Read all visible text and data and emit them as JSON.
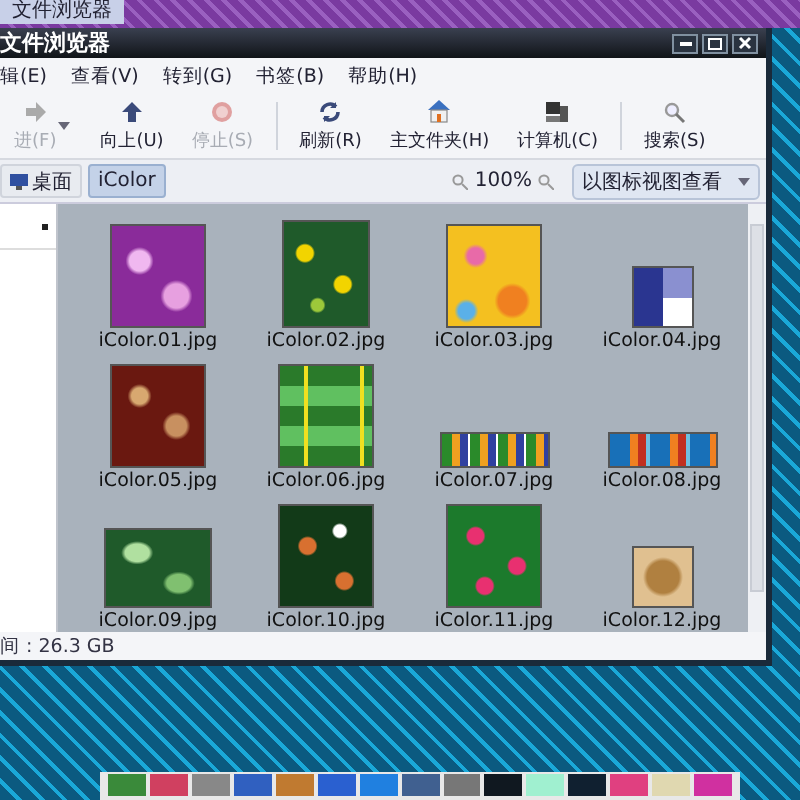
{
  "taskbar_tab": {
    "label": "文件浏览器"
  },
  "window": {
    "title": "文件浏览器"
  },
  "menu": [
    "辑(E)",
    "查看(V)",
    "转到(G)",
    "书签(B)",
    "帮助(H)"
  ],
  "toolbar": [
    {
      "kind": "forward",
      "label": "进(F)",
      "disabled": true
    },
    {
      "kind": "up",
      "label": "向上(U)",
      "disabled": false
    },
    {
      "kind": "stop",
      "label": "停止(S)",
      "disabled": true
    },
    {
      "kind": "reload",
      "label": "刷新(R)",
      "disabled": false
    },
    {
      "kind": "home",
      "label": "主文件夹(H)",
      "disabled": false
    },
    {
      "kind": "computer",
      "label": "计算机(C)",
      "disabled": false
    },
    {
      "kind": "search",
      "label": "搜索(S)",
      "disabled": false
    }
  ],
  "location": {
    "crumbs": [
      {
        "label": "桌面",
        "selected": false
      },
      {
        "label": "iColor",
        "selected": true
      }
    ],
    "zoom": "100%",
    "view_mode": "以图标视图查看"
  },
  "files": [
    {
      "name": "iColor.01.jpg",
      "kind": "square"
    },
    {
      "name": "iColor.02.jpg",
      "kind": "tall"
    },
    {
      "name": "iColor.03.jpg",
      "kind": "square"
    },
    {
      "name": "iColor.04.jpg",
      "kind": "small"
    },
    {
      "name": "iColor.05.jpg",
      "kind": "square"
    },
    {
      "name": "iColor.06.jpg",
      "kind": "square"
    },
    {
      "name": "iColor.07.jpg",
      "kind": "wide"
    },
    {
      "name": "iColor.08.jpg",
      "kind": "wide"
    },
    {
      "name": "iColor.09.jpg",
      "kind": "landscape"
    },
    {
      "name": "iColor.10.jpg",
      "kind": "square"
    },
    {
      "name": "iColor.11.jpg",
      "kind": "square"
    },
    {
      "name": "iColor.12.jpg",
      "kind": "small"
    }
  ],
  "status_bar": "间 : 26.3 GB"
}
